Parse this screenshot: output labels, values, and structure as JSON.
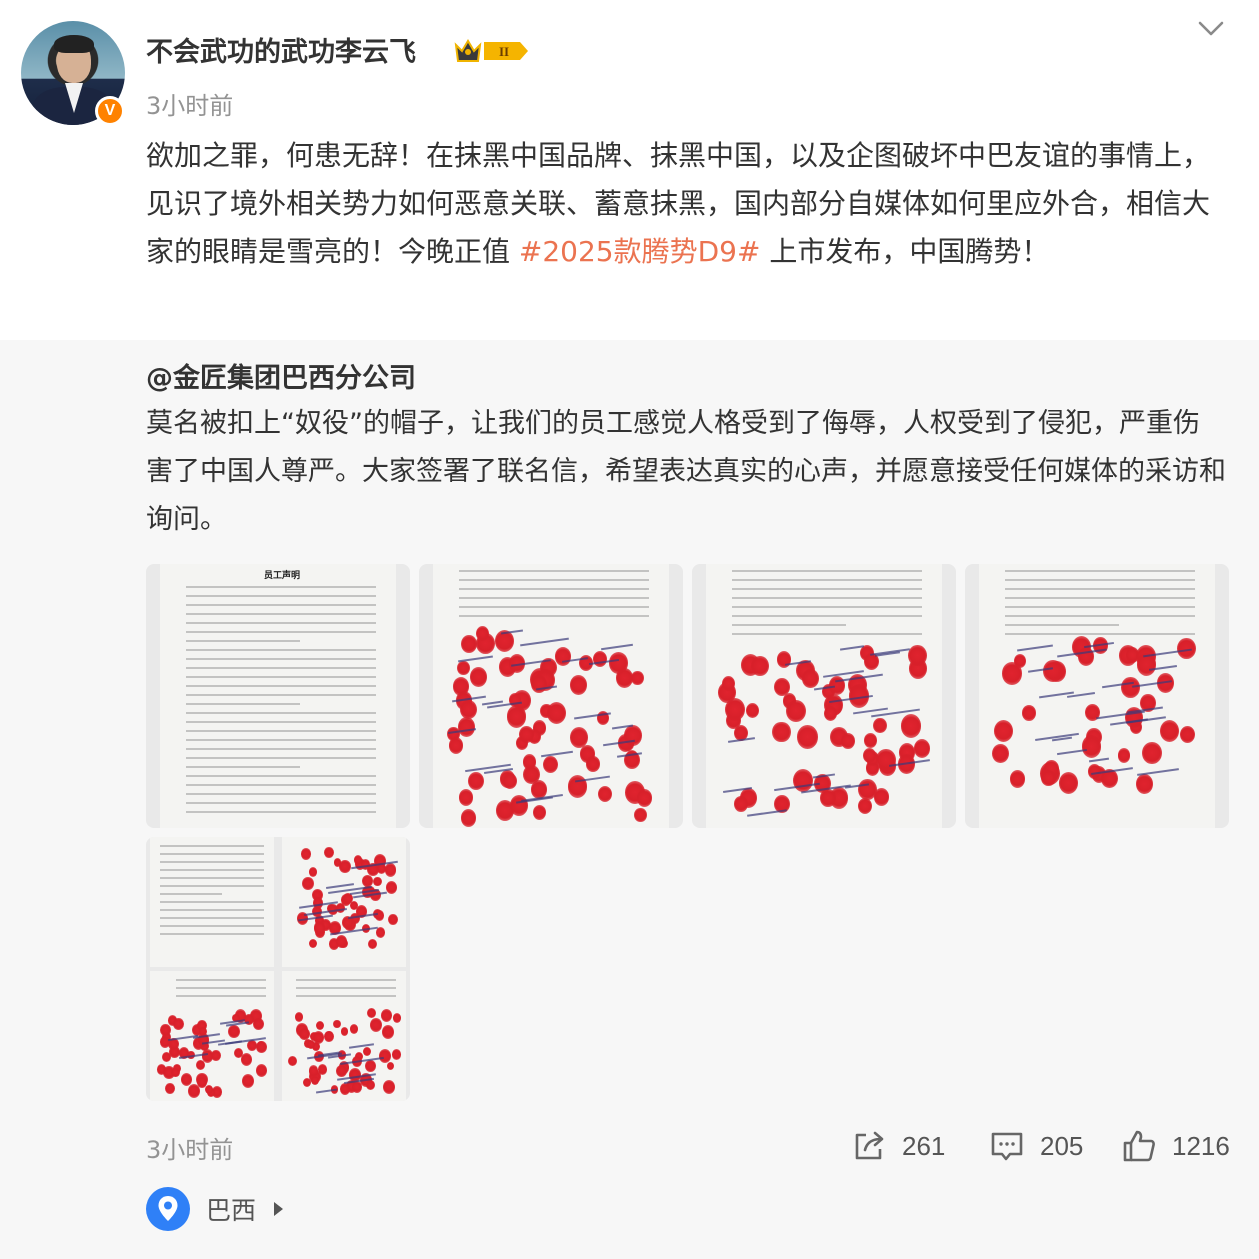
{
  "post": {
    "username": "不会武功的武功李云飞",
    "level_badge_text": "II",
    "verified_badge_text": "V",
    "timestamp": "3小时前",
    "text_before_hashtag": "欲加之罪，何患无辞！在抹黑中国品牌、抹黑中国，以及企图破坏中巴友谊的事情上，见识了境外相关势力如何恶意关联、蓄意抹黑，国内部分自媒体如何里应外合，相信大家的眼睛是雪亮的！今晚正值 ",
    "hashtag": "#2025款腾势D9#",
    "text_after_hashtag": " 上市发布，中国腾势！"
  },
  "repost": {
    "author": "@金匠集团巴西分公司",
    "text": "莫名被扣上“奴役”的帽子，让我们的员工感觉人格受到了侮辱，人权受到了侵犯，严重伤害了中国人尊严。大家签署了联名信，希望表达真实的心声，并愿意接受任何媒体的采访和询问。",
    "images": [
      {
        "title": "员工声明"
      },
      {
        "title": ""
      },
      {
        "title": ""
      },
      {
        "title": ""
      },
      {
        "title": ""
      }
    ]
  },
  "footer": {
    "timestamp": "3小时前",
    "repost_count": "261",
    "comment_count": "205",
    "like_count": "1216"
  },
  "location": {
    "label": "巴西"
  },
  "icons": {
    "menu": "chevron-down-icon",
    "repost": "repost-icon",
    "comment": "comment-icon",
    "like": "like-icon",
    "location": "location-pin-icon"
  },
  "colors": {
    "hashtag": "#eb7350",
    "verified": "#ff8200",
    "location_pin": "#2f80f7",
    "repost_background": "#f7f7f7"
  }
}
